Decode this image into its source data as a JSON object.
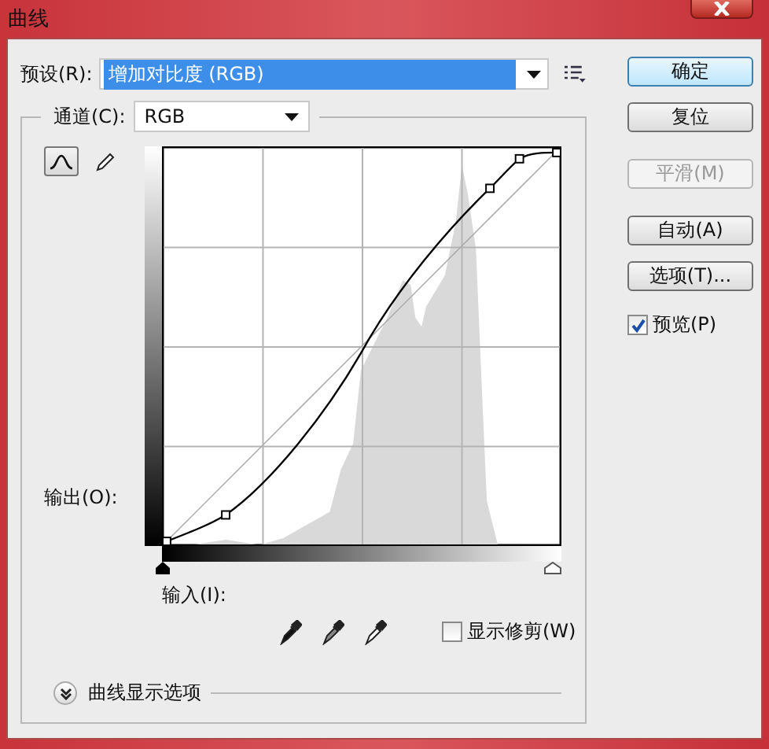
{
  "window": {
    "title": "曲线"
  },
  "preset": {
    "label": "预设(R):",
    "value": "增加对比度 (RGB)"
  },
  "channel": {
    "label": "通道(C):",
    "value": "RGB"
  },
  "tools": [
    {
      "kind": "curve",
      "selected": true
    },
    {
      "kind": "pencil",
      "selected": false
    }
  ],
  "output_label": "输出(O):",
  "input_label": "输入(I):",
  "show_clipping": {
    "label": "显示修剪(W)",
    "checked": false
  },
  "curve_display_options": {
    "label": "曲线显示选项"
  },
  "buttons": [
    {
      "label": "确定",
      "default": true,
      "disabled": false
    },
    {
      "label": "复位",
      "default": false,
      "disabled": false
    },
    {
      "label": "平滑(M)",
      "default": false,
      "disabled": true
    },
    {
      "label": "自动(A)",
      "default": false,
      "disabled": false
    },
    {
      "label": "选项(T)...",
      "default": false,
      "disabled": false
    }
  ],
  "preview": {
    "label": "预览(P)",
    "checked": true
  }
}
